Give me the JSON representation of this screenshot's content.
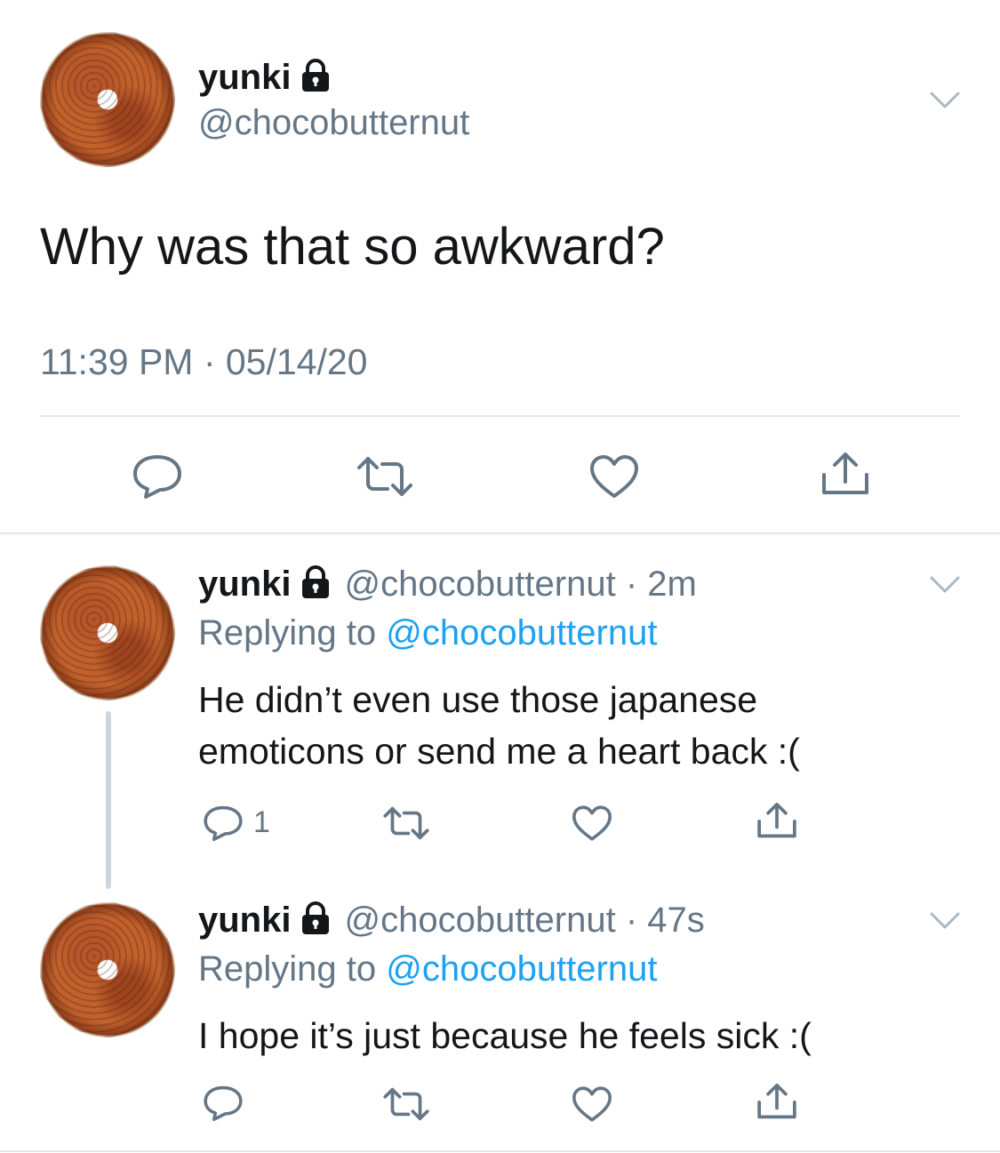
{
  "main_tweet": {
    "display_name": "yunki",
    "handle": "@chocobutternut",
    "text": "Why was that so awkward?",
    "timestamp": "11:39 PM · 05/14/20"
  },
  "replies": [
    {
      "display_name": "yunki",
      "handle": "@chocobutternut",
      "time": " · 2m",
      "replying_prefix": "Replying to ",
      "replying_to": "@chocobutternut",
      "text_line1": "He didn’t even use those japanese",
      "text_line2": "emoticons or send me a heart back :(",
      "reply_count": "1"
    },
    {
      "display_name": "yunki",
      "handle": "@chocobutternut",
      "time": " · 47s",
      "replying_prefix": "Replying to ",
      "replying_to": "@chocobutternut",
      "text_line1": "I hope it’s just because he feels sick :("
    }
  ],
  "colors": {
    "link": "#1da1f2",
    "secondary": "#657786",
    "divider": "#e1e8ed",
    "text": "#14171a"
  },
  "icons": [
    "lock-icon",
    "chevron-down-icon",
    "reply-icon",
    "retweet-icon",
    "like-icon",
    "share-icon"
  ]
}
